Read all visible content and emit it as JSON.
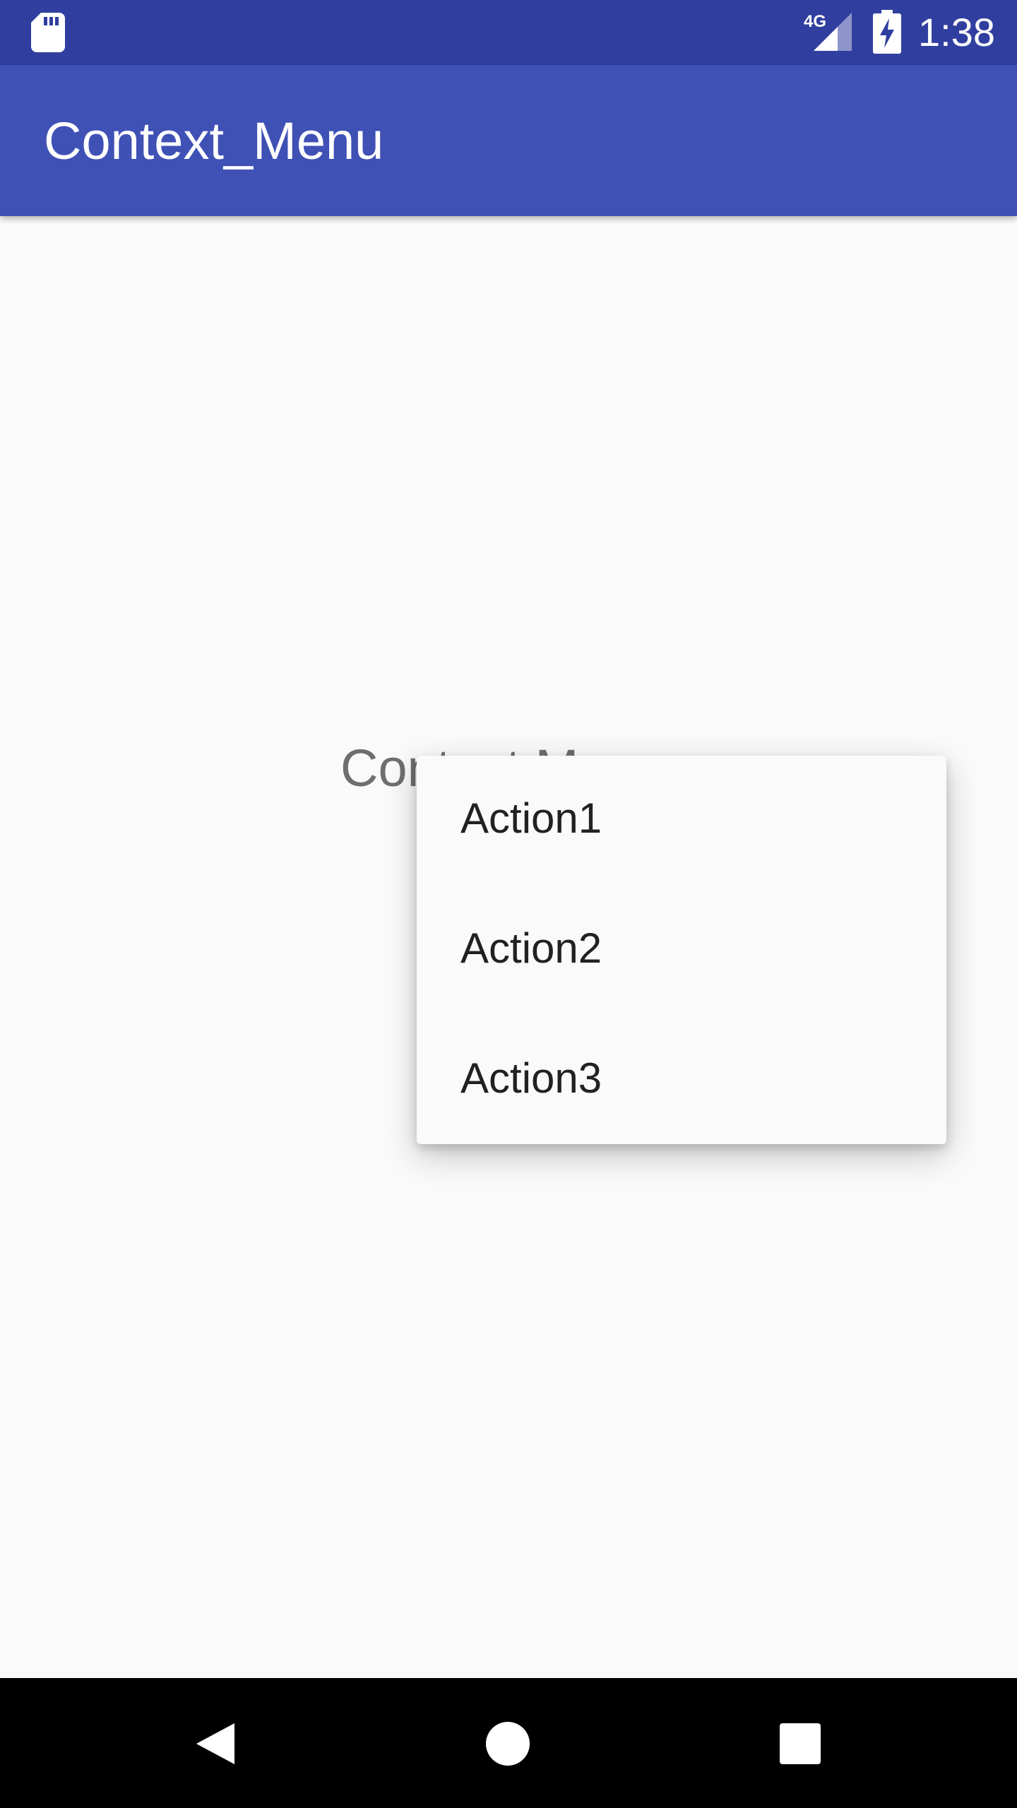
{
  "status_bar": {
    "time": "1:38",
    "network_label": "4G",
    "icons": [
      "sd-card-icon",
      "signal-4g-icon",
      "battery-charging-icon"
    ],
    "background": "#303F9F"
  },
  "app_bar": {
    "title": "Context_Menu",
    "background": "#3F51B5"
  },
  "content": {
    "label": "Context Menu"
  },
  "context_menu": {
    "items": [
      {
        "label": "Action1"
      },
      {
        "label": "Action2"
      },
      {
        "label": "Action3"
      }
    ]
  },
  "nav_bar": {
    "icons": [
      "back-icon",
      "home-icon",
      "recents-icon"
    ]
  }
}
